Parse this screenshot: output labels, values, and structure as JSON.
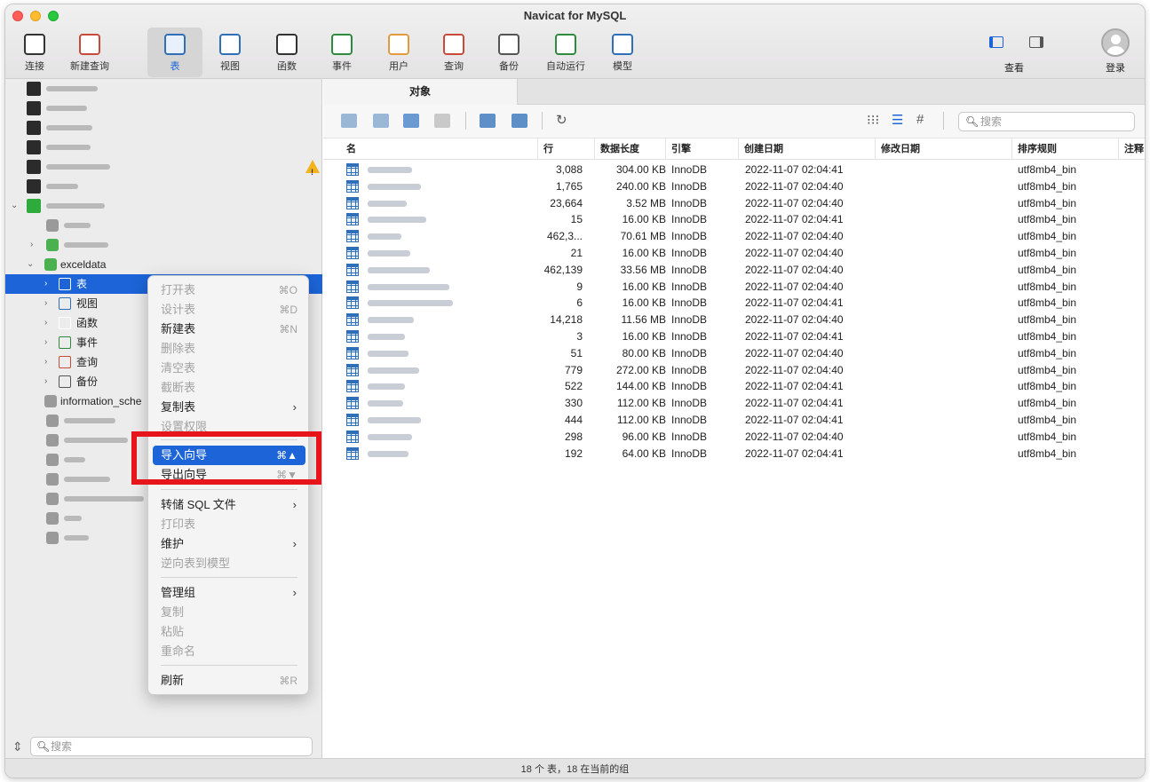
{
  "window": {
    "title": "Navicat for MySQL"
  },
  "toolbar": [
    {
      "label": "连接",
      "icon": "plug-icon"
    },
    {
      "label": "新建查询",
      "icon": "new-query-icon"
    },
    {
      "label": "表",
      "icon": "table-icon",
      "active": true
    },
    {
      "label": "视图",
      "icon": "view-icon"
    },
    {
      "label": "函数",
      "icon": "function-icon"
    },
    {
      "label": "事件",
      "icon": "clock-icon"
    },
    {
      "label": "用户",
      "icon": "user-icon"
    },
    {
      "label": "查询",
      "icon": "query-icon"
    },
    {
      "label": "备份",
      "icon": "backup-icon"
    },
    {
      "label": "自动运行",
      "icon": "schedule-icon"
    },
    {
      "label": "模型",
      "icon": "model-icon"
    }
  ],
  "toolbar_right": {
    "view_label": "查看",
    "login_label": "登录"
  },
  "sidebar": {
    "selected_db": "exceldata",
    "db_children": [
      {
        "label": "表"
      },
      {
        "label": "视图"
      },
      {
        "label": "函数"
      },
      {
        "label": "事件"
      },
      {
        "label": "查询"
      },
      {
        "label": "备份"
      }
    ],
    "information_schema": "information_sche",
    "search_placeholder": "搜索"
  },
  "tabs": {
    "active": "对象"
  },
  "search": {
    "placeholder": "搜索"
  },
  "table": {
    "columns": [
      "名",
      "行",
      "数据长度",
      "引擎",
      "创建日期",
      "修改日期",
      "排序规则",
      "注释"
    ],
    "rows": [
      {
        "rows": "3,088",
        "size": "304.00 KB",
        "engine": "InnoDB",
        "created": "2022-11-07 02:04:41",
        "collation": "utf8mb4_bin"
      },
      {
        "rows": "1,765",
        "size": "240.00 KB",
        "engine": "InnoDB",
        "created": "2022-11-07 02:04:40",
        "collation": "utf8mb4_bin"
      },
      {
        "rows": "23,664",
        "size": "3.52 MB",
        "engine": "InnoDB",
        "created": "2022-11-07 02:04:40",
        "collation": "utf8mb4_bin"
      },
      {
        "rows": "15",
        "size": "16.00 KB",
        "engine": "InnoDB",
        "created": "2022-11-07 02:04:41",
        "collation": "utf8mb4_bin"
      },
      {
        "rows": "462,3...",
        "size": "70.61 MB",
        "engine": "InnoDB",
        "created": "2022-11-07 02:04:40",
        "collation": "utf8mb4_bin"
      },
      {
        "rows": "21",
        "size": "16.00 KB",
        "engine": "InnoDB",
        "created": "2022-11-07 02:04:40",
        "collation": "utf8mb4_bin"
      },
      {
        "rows": "462,139",
        "size": "33.56 MB",
        "engine": "InnoDB",
        "created": "2022-11-07 02:04:40",
        "collation": "utf8mb4_bin"
      },
      {
        "rows": "9",
        "size": "16.00 KB",
        "engine": "InnoDB",
        "created": "2022-11-07 02:04:40",
        "collation": "utf8mb4_bin"
      },
      {
        "rows": "6",
        "size": "16.00 KB",
        "engine": "InnoDB",
        "created": "2022-11-07 02:04:41",
        "collation": "utf8mb4_bin"
      },
      {
        "rows": "14,218",
        "size": "11.56 MB",
        "engine": "InnoDB",
        "created": "2022-11-07 02:04:40",
        "collation": "utf8mb4_bin"
      },
      {
        "rows": "3",
        "size": "16.00 KB",
        "engine": "InnoDB",
        "created": "2022-11-07 02:04:41",
        "collation": "utf8mb4_bin"
      },
      {
        "rows": "51",
        "size": "80.00 KB",
        "engine": "InnoDB",
        "created": "2022-11-07 02:04:40",
        "collation": "utf8mb4_bin"
      },
      {
        "rows": "779",
        "size": "272.00 KB",
        "engine": "InnoDB",
        "created": "2022-11-07 02:04:40",
        "collation": "utf8mb4_bin"
      },
      {
        "rows": "522",
        "size": "144.00 KB",
        "engine": "InnoDB",
        "created": "2022-11-07 02:04:41",
        "collation": "utf8mb4_bin"
      },
      {
        "rows": "330",
        "size": "112.00 KB",
        "engine": "InnoDB",
        "created": "2022-11-07 02:04:41",
        "collation": "utf8mb4_bin"
      },
      {
        "rows": "444",
        "size": "112.00 KB",
        "engine": "InnoDB",
        "created": "2022-11-07 02:04:41",
        "collation": "utf8mb4_bin"
      },
      {
        "rows": "298",
        "size": "96.00 KB",
        "engine": "InnoDB",
        "created": "2022-11-07 02:04:40",
        "collation": "utf8mb4_bin"
      },
      {
        "rows": "192",
        "size": "64.00 KB",
        "engine": "InnoDB",
        "created": "2022-11-07 02:04:41",
        "collation": "utf8mb4_bin"
      }
    ]
  },
  "context_menu": {
    "items": [
      {
        "label": "打开表",
        "shortcut": "⌘O",
        "disabled": true
      },
      {
        "label": "设计表",
        "shortcut": "⌘D",
        "disabled": true
      },
      {
        "label": "新建表",
        "shortcut": "⌘N",
        "disabled": false
      },
      {
        "label": "删除表",
        "shortcut": "",
        "disabled": true
      },
      {
        "label": "清空表",
        "shortcut": "",
        "disabled": true
      },
      {
        "label": "截断表",
        "shortcut": "",
        "disabled": true
      },
      {
        "label": "复制表",
        "shortcut": "",
        "disabled": false,
        "submenu": true
      },
      {
        "label": "设置权限",
        "shortcut": "",
        "disabled": true
      },
      {
        "label": "导入向导",
        "shortcut": "⌘▲",
        "disabled": false,
        "highlighted": true
      },
      {
        "label": "导出向导",
        "shortcut": "⌘▼",
        "disabled": false
      },
      {
        "label": "转储 SQL 文件",
        "shortcut": "",
        "disabled": false,
        "submenu": true
      },
      {
        "label": "打印表",
        "shortcut": "",
        "disabled": true
      },
      {
        "label": "维护",
        "shortcut": "",
        "disabled": false,
        "submenu": true
      },
      {
        "label": "逆向表到模型",
        "shortcut": "",
        "disabled": true
      },
      {
        "label": "管理组",
        "shortcut": "",
        "disabled": false,
        "submenu": true
      },
      {
        "label": "复制",
        "shortcut": "",
        "disabled": true
      },
      {
        "label": "粘贴",
        "shortcut": "",
        "disabled": true
      },
      {
        "label": "重命名",
        "shortcut": "",
        "disabled": true
      },
      {
        "label": "刷新",
        "shortcut": "⌘R",
        "disabled": false
      }
    ]
  },
  "status": {
    "text": "18 个 表，18 在当前的组"
  },
  "colors": {
    "selection": "#1c64d8",
    "highlight_box": "#e8141b",
    "warning": "#f3b31b"
  }
}
